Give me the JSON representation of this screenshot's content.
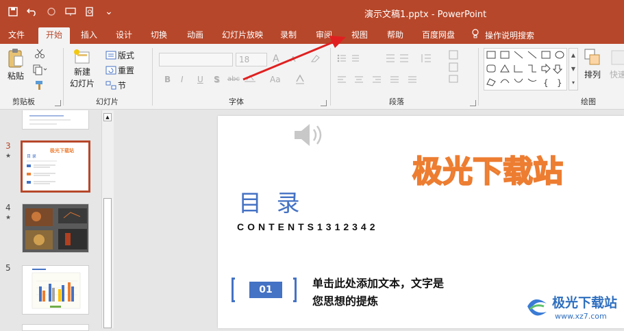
{
  "window": {
    "title": "演示文稿1.pptx  -  PowerPoint"
  },
  "qat": {
    "more": "⌄"
  },
  "tabs": [
    "文件",
    "开始",
    "插入",
    "设计",
    "切换",
    "动画",
    "幻灯片放映",
    "录制",
    "审阅",
    "视图",
    "帮助",
    "百度网盘",
    "操作说明搜索"
  ],
  "ribbon": {
    "clipboard": {
      "paste": "粘贴",
      "label": "剪贴板"
    },
    "slides": {
      "new_slide_1": "新建",
      "new_slide_2": "幻灯片",
      "layout": "版式",
      "reset": "重置",
      "section": "节",
      "label": "幻灯片"
    },
    "font": {
      "size": "18",
      "bold": "B",
      "italic": "I",
      "underline": "U",
      "shadow": "S",
      "strike": "abc",
      "case": "Aa",
      "grow": "A",
      "shrink": "A",
      "label": "字体"
    },
    "paragraph": {
      "label": "段落"
    },
    "drawing": {
      "arrange": "排列",
      "quick": "快速",
      "label": "绘图",
      "shape_glyphs": [
        "▭",
        "⬚",
        "\\",
        "╲",
        "▭",
        "▭",
        "○",
        "▭",
        "△",
        "⌐",
        "⌐",
        "⇨",
        "⇩",
        "☆",
        "⌒",
        "⌒",
        "⌒",
        "{",
        "}",
        "☆"
      ]
    }
  },
  "thumbnails": [
    {
      "num": "3",
      "star": "★",
      "title": "极光下载站",
      "heading": "目 录"
    },
    {
      "num": "4",
      "star": "★"
    },
    {
      "num": "5"
    }
  ],
  "slide": {
    "watermark": "极光下载站",
    "heading": "目  录",
    "contents": "CONTENTS1312342",
    "item_number": "01",
    "item_text_1": "单击此处添加文本，文字是",
    "item_text_2": "您思想的提炼"
  },
  "site_logo": {
    "name": "极光下载站",
    "url": "www.xz7.com"
  },
  "colors": {
    "accent": "#b7472a",
    "slide_blue": "#4472c4",
    "watermark_fill": "#ffd966",
    "watermark_stroke": "#ed7d31",
    "arrow": "#e02020"
  }
}
